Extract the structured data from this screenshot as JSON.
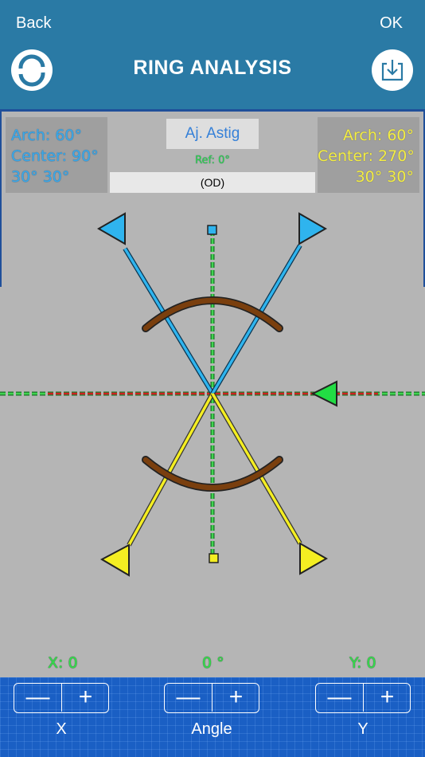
{
  "header": {
    "back_label": "Back",
    "ok_label": "OK",
    "title": "RING ANALYSIS",
    "reset_icon": "refresh-icon",
    "save_icon": "download-icon",
    "color": "#2a7aa5"
  },
  "left_info": {
    "arch": "Arch: 60°",
    "center": "Center: 90°",
    "angles": "30°  30°",
    "color": "#3aa8e8"
  },
  "right_info": {
    "arch": "Arch: 60°",
    "center": "Center: 270°",
    "angles": "30°  30°",
    "color": "#f4ee44"
  },
  "astig_button_label": "Aj. Astig",
  "ref_label": "Ref: 0°",
  "eye_label": "(OD)",
  "readouts": {
    "x": "X: 0",
    "angle": "0 °",
    "y": "Y: 0"
  },
  "controls": {
    "minus_symbol": "—",
    "plus_symbol": "+",
    "x_label": "X",
    "angle_label": "Angle",
    "y_label": "Y"
  },
  "colors": {
    "blue_marker": "#2fb4ee",
    "yellow_marker": "#f4ee22",
    "arc": "#7a3f0e",
    "guide": "#2bc53a",
    "axis_red": "#d02020",
    "green_marker": "#22dd44"
  }
}
